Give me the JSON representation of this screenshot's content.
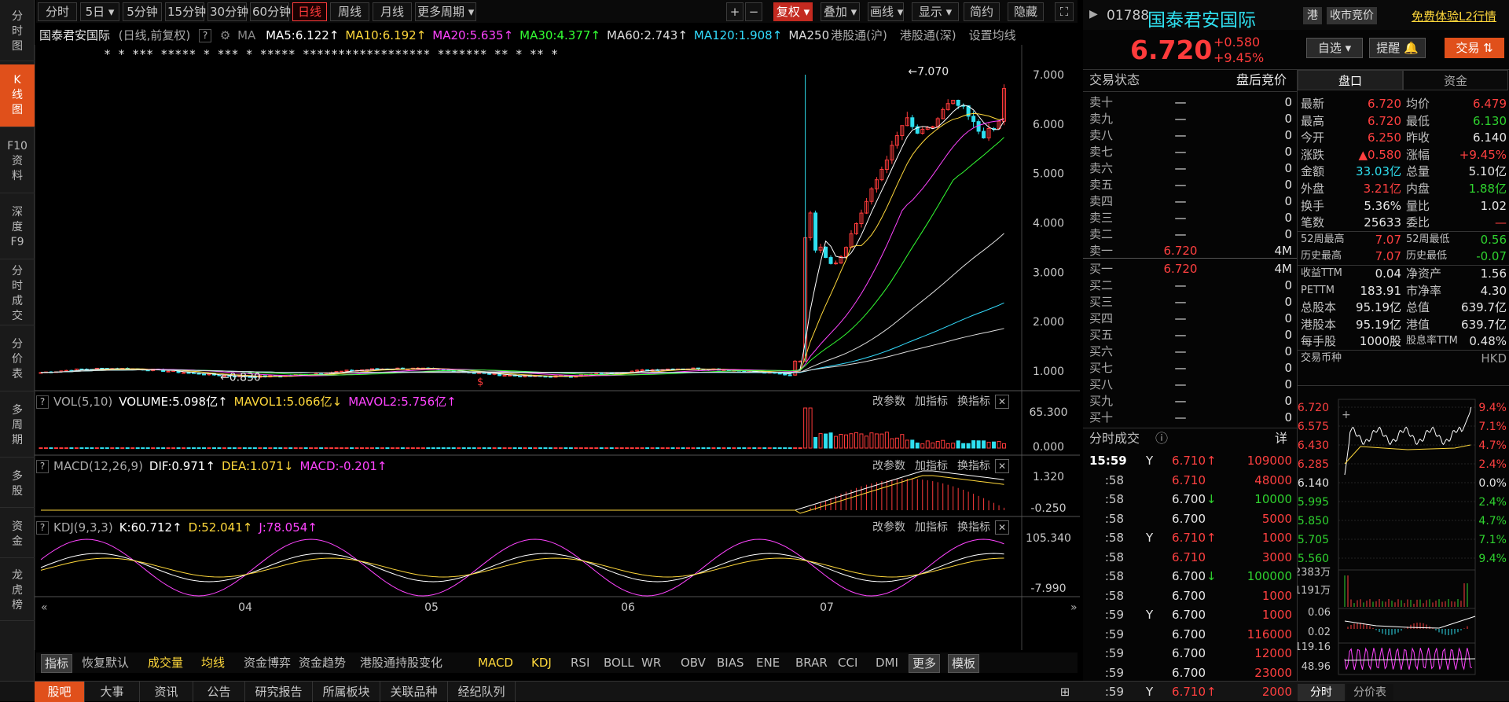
{
  "sidebar": [
    {
      "label": [
        "分",
        "时",
        "图"
      ],
      "active": false
    },
    {
      "label": [
        "K",
        "线",
        "图"
      ],
      "active": true
    },
    {
      "label": [
        "F10",
        "资",
        "料"
      ],
      "active": false
    },
    {
      "label": [
        "深",
        "度",
        "F9"
      ],
      "active": false
    },
    {
      "label": [
        "分",
        "时",
        "成",
        "交"
      ],
      "active": false
    },
    {
      "label": [
        "分",
        "价",
        "表"
      ],
      "active": false
    },
    {
      "label": [
        "多",
        "周",
        "期"
      ],
      "active": false
    },
    {
      "label": [
        "多",
        "股"
      ],
      "active": false
    },
    {
      "label": [
        "资",
        "金"
      ],
      "active": false
    },
    {
      "label": [
        "龙",
        "虎",
        "榜"
      ],
      "active": false
    }
  ],
  "toolbar": {
    "periods": [
      "分时",
      "5日",
      "5分钟",
      "15分钟",
      "30分钟",
      "60分钟",
      "日线",
      "周线",
      "月线",
      "更多周期"
    ],
    "active_period": "日线",
    "right": [
      "+",
      "−",
      "复权",
      "叠加",
      "画线",
      "显示",
      "简约",
      "隐藏"
    ]
  },
  "ma_row": {
    "name": "国泰君安国际",
    "mode": "(日线,前复权)",
    "ma_label": "MA",
    "items": [
      {
        "text": "MA5:6.122",
        "color": "#ffffff"
      },
      {
        "text": "MA10:6.192",
        "color": "#ffd83b"
      },
      {
        "text": "MA20:5.635",
        "color": "#ff44ff"
      },
      {
        "text": "MA30:4.377",
        "color": "#33ff33"
      },
      {
        "text": "MA60:2.743",
        "color": "#dddddd"
      },
      {
        "text": "MA120:1.908",
        "color": "#33ddff"
      },
      {
        "text": "MA250",
        "color": "#dddddd"
      }
    ],
    "extras": [
      "港股通(沪)",
      "港股通(深)",
      "设置均线"
    ]
  },
  "main_axis": [
    "7.000",
    "6.000",
    "5.000",
    "4.000",
    "3.000",
    "2.000",
    "1.000"
  ],
  "annotations": {
    "high": "7.070",
    "low": "0.830"
  },
  "stars": "* * *** ***** * *** * ***** ****************** ******* ** * ** *",
  "vol": {
    "name": "VOL(5,10)",
    "items": [
      {
        "text": "VOLUME:5.098亿",
        "color": "#ffffff"
      },
      {
        "text": "MAVOL1:5.066亿",
        "color": "#ffd83b"
      },
      {
        "text": "MAVOL2:5.756亿",
        "color": "#ff44ff"
      }
    ],
    "axis": [
      "65.300",
      "0.000"
    ]
  },
  "macd": {
    "name": "MACD(12,26,9)",
    "items": [
      {
        "text": "DIF:0.971",
        "color": "#ffffff"
      },
      {
        "text": "DEA:1.071",
        "color": "#ffd83b"
      },
      {
        "text": "MACD:-0.201",
        "color": "#ff44ff"
      }
    ],
    "axis": [
      "1.320",
      "-0.250"
    ]
  },
  "kdj": {
    "name": "KDJ(9,3,3)",
    "items": [
      {
        "text": "K:60.712",
        "color": "#ffffff"
      },
      {
        "text": "D:52.041",
        "color": "#ffd83b"
      },
      {
        "text": "J:78.054",
        "color": "#ff44ff"
      }
    ],
    "axis": [
      "105.340",
      "-7.990"
    ]
  },
  "panel_buttons": [
    "改参数",
    "加指标",
    "换指标"
  ],
  "months": [
    "04",
    "05",
    "06",
    "07"
  ],
  "indicator_tabs": [
    "指标",
    "恢复默认",
    "成交量",
    "均线",
    "资金博弈",
    "资金趋势",
    "港股通持股变化",
    "MACD",
    "KDJ",
    "RSI",
    "BOLL",
    "WR",
    "OBV",
    "BIAS",
    "ENE",
    "BRAR",
    "CCI",
    "DMI",
    "更多",
    "模板"
  ],
  "bottom_tabs": [
    "股吧",
    "大事",
    "资讯",
    "公告",
    "研究报告",
    "所属板块",
    "关联品种",
    "经纪队列"
  ],
  "quote": {
    "code": "01788",
    "name": "国泰君安国际",
    "price": "6.720",
    "change": "+0.580",
    "change_pct": "+9.45%",
    "market": "港",
    "session": "收市竞价",
    "promo": "免费体验L2行情",
    "buttons": [
      "自选",
      "提醒",
      "交易"
    ]
  },
  "orderbook": {
    "title": "交易状态",
    "status": "盘后竞价",
    "sells": [
      {
        "label": "卖十",
        "price": "—",
        "vol": "0"
      },
      {
        "label": "卖九",
        "price": "—",
        "vol": "0"
      },
      {
        "label": "卖八",
        "price": "—",
        "vol": "0"
      },
      {
        "label": "卖七",
        "price": "—",
        "vol": "0"
      },
      {
        "label": "卖六",
        "price": "—",
        "vol": "0"
      },
      {
        "label": "卖五",
        "price": "—",
        "vol": "0"
      },
      {
        "label": "卖四",
        "price": "—",
        "vol": "0"
      },
      {
        "label": "卖三",
        "price": "—",
        "vol": "0"
      },
      {
        "label": "卖二",
        "price": "—",
        "vol": "0"
      },
      {
        "label": "卖一",
        "price": "6.720",
        "vol": "4M"
      }
    ],
    "buys": [
      {
        "label": "买一",
        "price": "6.720",
        "vol": "4M"
      },
      {
        "label": "买二",
        "price": "—",
        "vol": "0"
      },
      {
        "label": "买三",
        "price": "—",
        "vol": "0"
      },
      {
        "label": "买四",
        "price": "—",
        "vol": "0"
      },
      {
        "label": "买五",
        "price": "—",
        "vol": "0"
      },
      {
        "label": "买六",
        "price": "—",
        "vol": "0"
      },
      {
        "label": "买七",
        "price": "—",
        "vol": "0"
      },
      {
        "label": "买八",
        "price": "—",
        "vol": "0"
      },
      {
        "label": "买九",
        "price": "—",
        "vol": "0"
      },
      {
        "label": "买十",
        "price": "—",
        "vol": "0"
      }
    ]
  },
  "ticks_header": {
    "title": "分时成交",
    "detail": "详"
  },
  "ticks": [
    {
      "time": "15:59",
      "flag": "Y",
      "price": "6.710",
      "dir": "up",
      "vol": "109000"
    },
    {
      "time": ":58",
      "flag": "",
      "price": "6.710",
      "dir": "",
      "vol": "48000"
    },
    {
      "time": ":58",
      "flag": "",
      "price": "6.700",
      "dir": "down",
      "vol": "10000"
    },
    {
      "time": ":58",
      "flag": "",
      "price": "6.700",
      "dir": "",
      "vol": "5000"
    },
    {
      "time": ":58",
      "flag": "Y",
      "price": "6.710",
      "dir": "up",
      "vol": "1000"
    },
    {
      "time": ":58",
      "flag": "",
      "price": "6.710",
      "dir": "",
      "vol": "3000"
    },
    {
      "time": ":58",
      "flag": "",
      "price": "6.700",
      "dir": "down",
      "vol": "100000"
    },
    {
      "time": ":58",
      "flag": "",
      "price": "6.700",
      "dir": "",
      "vol": "1000"
    },
    {
      "time": ":59",
      "flag": "Y",
      "price": "6.700",
      "dir": "",
      "vol": "1000"
    },
    {
      "time": ":59",
      "flag": "",
      "price": "6.700",
      "dir": "",
      "vol": "116000"
    },
    {
      "time": ":59",
      "flag": "",
      "price": "6.700",
      "dir": "",
      "vol": "12000"
    },
    {
      "time": ":59",
      "flag": "",
      "price": "6.700",
      "dir": "",
      "vol": "23000"
    },
    {
      "time": ":59",
      "flag": "Y",
      "price": "6.710",
      "dir": "up",
      "vol": "2000"
    }
  ],
  "tabs_right": [
    "盘口",
    "资金"
  ],
  "stats": [
    {
      "l1": "最新",
      "v1": "6.720",
      "c1": "red",
      "l2": "均价",
      "v2": "6.479",
      "c2": "red"
    },
    {
      "l1": "最高",
      "v1": "6.720",
      "c1": "red",
      "l2": "最低",
      "v2": "6.130",
      "c2": "grn"
    },
    {
      "l1": "今开",
      "v1": "6.250",
      "c1": "red",
      "l2": "昨收",
      "v2": "6.140",
      "c2": "wht"
    },
    {
      "l1": "涨跌",
      "v1": "▲0.580",
      "c1": "red",
      "l2": "涨幅",
      "v2": "+9.45%",
      "c2": "red"
    },
    {
      "l1": "金额",
      "v1": "33.03亿",
      "c1": "cyan",
      "l2": "总量",
      "v2": "5.10亿",
      "c2": "wht"
    },
    {
      "l1": "外盘",
      "v1": "3.21亿",
      "c1": "red",
      "l2": "内盘",
      "v2": "1.88亿",
      "c2": "grn"
    },
    {
      "l1": "换手",
      "v1": "5.36%",
      "c1": "wht",
      "l2": "量比",
      "v2": "1.02",
      "c2": "wht"
    },
    {
      "l1": "笔数",
      "v1": "25633",
      "c1": "wht",
      "l2": "委比",
      "v2": "—",
      "c2": "red"
    },
    {
      "l1": "52周最高",
      "v1": "7.07",
      "c1": "red",
      "l2": "52周最低",
      "v2": "0.56",
      "c2": "grn"
    },
    {
      "l1": "历史最高",
      "v1": "7.07",
      "c1": "red",
      "l2": "历史最低",
      "v2": "-0.07",
      "c2": "grn"
    },
    {
      "l1": "收益TTM",
      "v1": "0.04",
      "c1": "wht",
      "l2": "净资产",
      "v2": "1.56",
      "c2": "wht"
    },
    {
      "l1": "PETTM",
      "v1": "183.91",
      "c1": "wht",
      "l2": "市净率",
      "v2": "4.30",
      "c2": "wht"
    },
    {
      "l1": "总股本",
      "v1": "95.19亿",
      "c1": "wht",
      "l2": "总值",
      "v2": "639.7亿",
      "c2": "wht"
    },
    {
      "l1": "港股本",
      "v1": "95.19亿",
      "c1": "wht",
      "l2": "港值",
      "v2": "639.7亿",
      "c2": "wht"
    },
    {
      "l1": "每手股",
      "v1": "1000股",
      "c1": "wht",
      "l2": "股息率TTM",
      "v2": "0.48%",
      "c2": "wht"
    },
    {
      "l1": "交易币种",
      "v1": "",
      "c1": "wht",
      "l2": "",
      "v2": "HKD",
      "c2": "gry"
    }
  ],
  "mini": {
    "left": [
      "6.720",
      "6.575",
      "6.430",
      "6.285",
      "6.140",
      "5.995",
      "5.850",
      "5.705",
      "5.560"
    ],
    "right": [
      "9.4%",
      "7.1%",
      "4.7%",
      "2.4%",
      "0.0%",
      "2.4%",
      "4.7%",
      "7.1%",
      "9.4%"
    ],
    "vol": [
      "2383万",
      "1191万"
    ],
    "macd": [
      "0.06",
      "0.02"
    ],
    "kdj": [
      "119.16",
      "48.96"
    ],
    "tabs": [
      "分时",
      "分价表"
    ]
  },
  "colors": {
    "up": "#ff3b3b",
    "down": "#2fe0f0",
    "accent": "#e0501b"
  }
}
